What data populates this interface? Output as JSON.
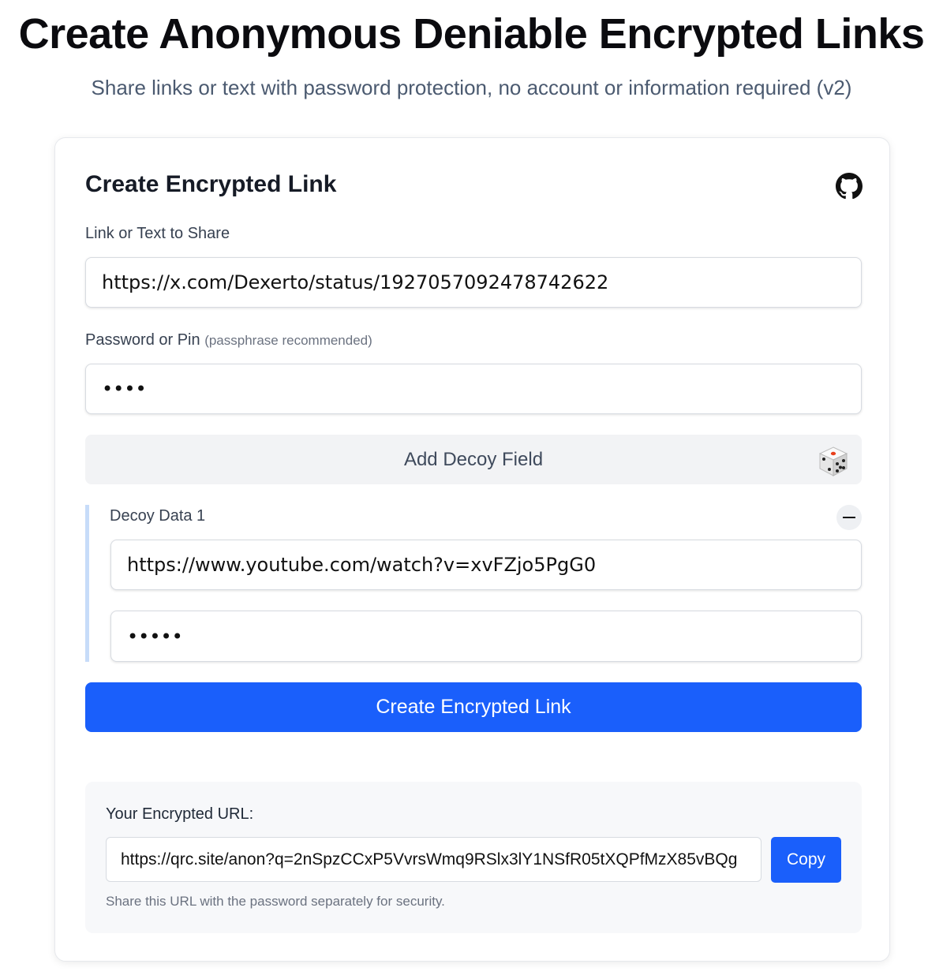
{
  "header": {
    "title": "Create Anonymous Deniable Encrypted Links",
    "subtitle": "Share links or text with password protection, no account or information required (v2)"
  },
  "card": {
    "title": "Create Encrypted Link",
    "github_icon": "github-icon",
    "link_field": {
      "label": "Link or Text to Share",
      "value": "https://x.com/Dexerto/status/1927057092478742622"
    },
    "password_field": {
      "label": "Password or Pin",
      "hint": "(passphrase recommended)",
      "value": "••••"
    },
    "decoy_button": {
      "label": "Add Decoy Field",
      "icon": "dice-icon"
    },
    "decoy": {
      "label": "Decoy Data 1",
      "remove_icon": "minus-icon",
      "link_value": "https://www.youtube.com/watch?v=xvFZjo5PgG0",
      "password_value": "•••••"
    },
    "submit_label": "Create Encrypted Link"
  },
  "result": {
    "label": "Your Encrypted URL:",
    "url": "https://qrc.site/anon?q=2nSpzCCxP5VvrsWmq9RSlx3lY1NSfR05tXQPfMzX85vBQg",
    "copy_label": "Copy",
    "note": "Share this URL with the password separately for security."
  },
  "colors": {
    "accent": "#1a5ffb",
    "decoy_bar": "#c7dcf9",
    "decoy_button_bg": "#f2f3f5",
    "result_bg": "#f7f8fa",
    "dice_pip_red": "#e8401c"
  }
}
